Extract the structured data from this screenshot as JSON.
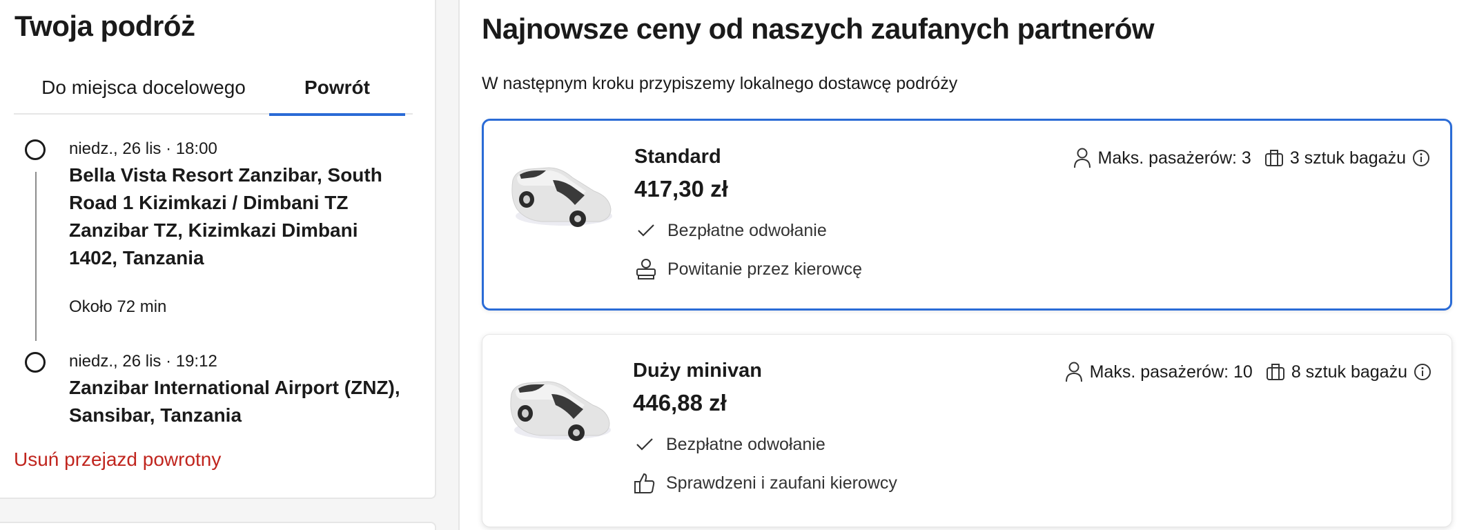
{
  "trip": {
    "title": "Twoja podróż",
    "tabs": [
      {
        "label": "Do miejsca docelowego",
        "active": false
      },
      {
        "label": "Powrót",
        "active": true
      }
    ],
    "stops": [
      {
        "time": "niedz., 26 lis · 18:00",
        "place": "Bella Vista Resort Zanzibar, South Road 1 Kizimkazi / Dimbani TZ Zanzibar TZ, Kizimkazi Dimbani 1402, Tanzania"
      },
      {
        "time": "niedz., 26 lis · 19:12",
        "place": "Zanzibar International Airport (ZNZ), Sansibar, Tanzania"
      }
    ],
    "duration": "Około 72 min",
    "remove_return": "Usuń przejazd powrotny"
  },
  "offers": {
    "title": "Najnowsze ceny od naszych zaufanych partnerów",
    "subtitle": "W następnym kroku przypiszemy lokalnego dostawcę podróży",
    "cards": [
      {
        "name": "Standard",
        "price": "417,30 zł",
        "passengers": "Maks. pasażerów: 3",
        "luggage": "3 sztuk bagażu",
        "features": [
          {
            "icon": "check-icon",
            "label": "Bezpłatne odwołanie"
          },
          {
            "icon": "driver-greeting-icon",
            "label": "Powitanie przez kierowcę"
          }
        ],
        "selected": true
      },
      {
        "name": "Duży minivan",
        "price": "446,88 zł",
        "passengers": "Maks. pasażerów: 10",
        "luggage": "8 sztuk bagażu",
        "features": [
          {
            "icon": "check-icon",
            "label": "Bezpłatne odwołanie"
          },
          {
            "icon": "thumbs-up-icon",
            "label": "Sprawdzeni i zaufani kierowcy"
          }
        ],
        "selected": false
      }
    ]
  },
  "colors": {
    "accent": "#2a6bd6",
    "danger": "#c0251e",
    "text": "#1a1a1a"
  }
}
